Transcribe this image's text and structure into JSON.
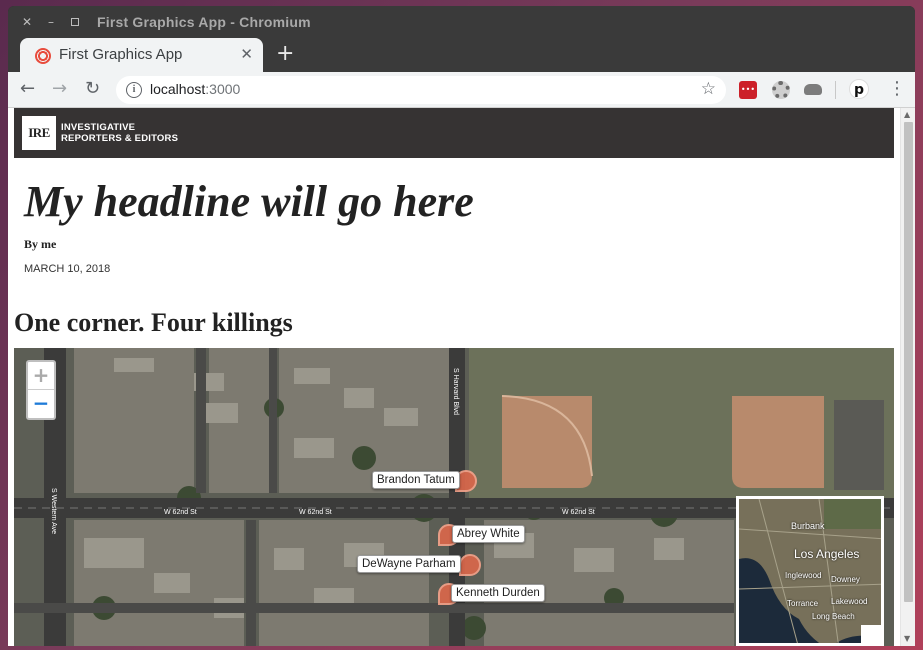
{
  "window": {
    "title": "First Graphics App - Chromium"
  },
  "tab": {
    "title": "First Graphics App",
    "close_glyph": "✕",
    "new_tab_glyph": "+"
  },
  "toolbar": {
    "url_host": "localhost",
    "url_port": ":3000",
    "back_glyph": "←",
    "forward_glyph": "→",
    "reload_glyph": "↻",
    "star_glyph": "☆",
    "menu_glyph": "⋮",
    "profile_letter": "p",
    "lastpass_text": "•••"
  },
  "header": {
    "logo_text": "IRE",
    "org_line1": "INVESTIGATIVE",
    "org_line2": "REPORTERS & EDITORS"
  },
  "article": {
    "headline": "My headline will go here",
    "byline": "By me",
    "date": "MARCH 10, 2018",
    "subhead": "One corner. Four killings"
  },
  "map": {
    "zoom_in": "+",
    "zoom_out": "−",
    "markers": [
      {
        "label": "Brandon Tatum"
      },
      {
        "label": "Abrey White"
      },
      {
        "label": "DeWayne Parham"
      },
      {
        "label": "Kenneth Durden"
      }
    ],
    "street_labels": [
      "W 62nd St",
      "W 62nd St",
      "W 62nd St",
      "S Western Ave",
      "S Harvard Blvd"
    ],
    "minimap_labels": [
      "Burbank",
      "Los Angeles",
      "Inglewood",
      "Downey",
      "Torrance",
      "Lakewood",
      "Long Beach"
    ]
  },
  "colors": {
    "header_bg": "#363333",
    "marker": "#d9674b",
    "zoom_out": "#1f7bd8"
  }
}
